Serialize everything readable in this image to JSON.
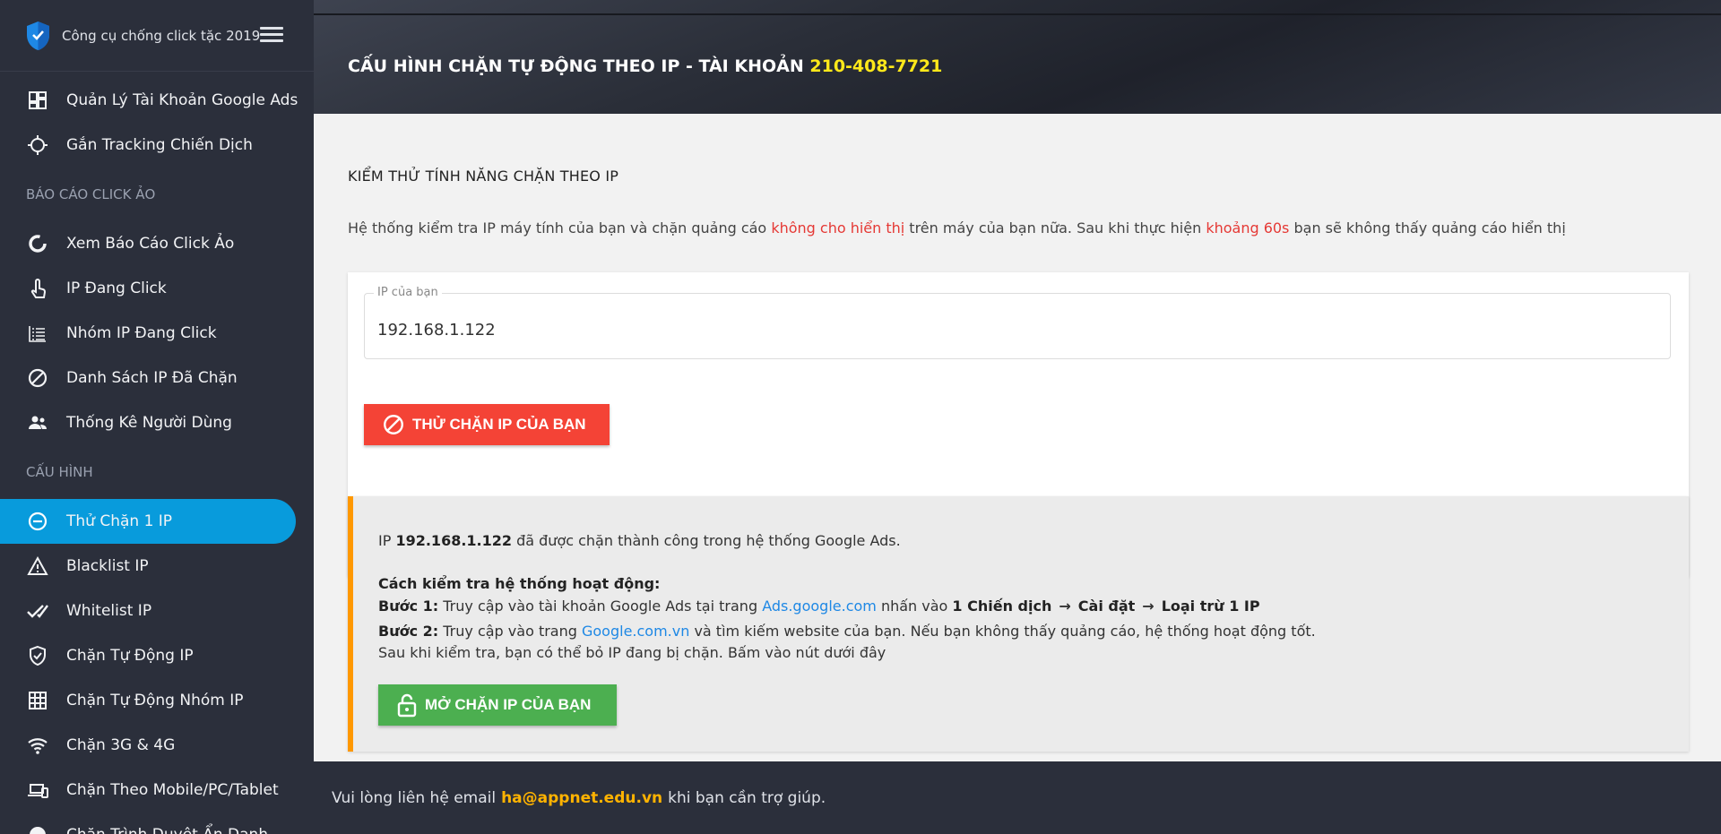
{
  "sidebar": {
    "brand": "Công cụ chống click tặc 2019",
    "items_top": [
      {
        "label": "Quản Lý Tài Khoản Google Ads",
        "icon": "dashboard-icon"
      },
      {
        "label": "Gắn Tracking Chiến Dịch",
        "icon": "crosshair-icon"
      }
    ],
    "section_reports": "BÁO CÁO CLICK ẢO",
    "items_reports": [
      {
        "label": "Xem Báo Cáo Click Ảo",
        "icon": "donut-chart-icon"
      },
      {
        "label": "IP Đang Click",
        "icon": "touch-icon"
      },
      {
        "label": "Nhóm IP Đang Click",
        "icon": "list-icon"
      },
      {
        "label": "Danh Sách IP Đã Chặn",
        "icon": "block-icon"
      },
      {
        "label": "Thống Kê Người Dùng",
        "icon": "users-icon"
      }
    ],
    "section_config": "CẤU HÌNH",
    "items_config": [
      {
        "label": "Thử Chặn 1 IP",
        "icon": "minus-circle-icon",
        "active": true
      },
      {
        "label": "Blacklist IP",
        "icon": "warning-icon"
      },
      {
        "label": "Whitelist IP",
        "icon": "double-check-icon"
      },
      {
        "label": "Chặn Tự Động IP",
        "icon": "shield-check-icon"
      },
      {
        "label": "Chặn Tự Động Nhóm IP",
        "icon": "grid-icon"
      },
      {
        "label": "Chặn 3G & 4G",
        "icon": "wifi-icon"
      },
      {
        "label": "Chặn Theo Mobile/PC/Tablet",
        "icon": "devices-icon"
      },
      {
        "label": "Chặn Trình Duyệt Ẩn Danh",
        "icon": "incognito-icon"
      }
    ]
  },
  "header": {
    "title_prefix": "CẤU HÌNH CHẶN TỰ ĐỘNG THEO IP - TÀI KHOẢN ",
    "account": "210-408-7721"
  },
  "main": {
    "section_title": "KIỂM THỬ TÍNH NĂNG CHẶN THEO IP",
    "desc_1": "Hệ thống kiểm tra IP máy tính của bạn và chặn quảng cáo ",
    "desc_red_1": "không cho hiển thị",
    "desc_2": " trên máy của bạn nữa. Sau khi thực hiện ",
    "desc_red_2": "khoảng 60s",
    "desc_3": " bạn sẽ không thấy quảng cáo hiển thị",
    "ip_label": "IP của bạn",
    "ip_value": "192.168.1.122",
    "block_button": "THỬ CHẶN IP CỦA BẠN"
  },
  "result": {
    "ip_prefix": "IP ",
    "ip": "192.168.1.122",
    "ip_suffix": " đã được chặn thành công trong hệ thống Google Ads.",
    "howto_title": "Cách kiểm tra hệ thống hoạt động:",
    "step1_label": "Bước 1:",
    "step1_text": " Truy cập vào tài khoản Google Ads tại trang ",
    "step1_link": "Ads.google.com",
    "step1_text2": " nhấn vào ",
    "step1_b1": "1 Chiến dịch",
    "step1_b2": "Cài đặt",
    "step1_b3": "Loại trừ 1 IP",
    "arrow": "→",
    "step2_label": "Bước 2:",
    "step2_text": " Truy cập vào trang ",
    "step2_link": "Google.com.vn",
    "step2_text2": " và tìm kiếm website của bạn. Nếu bạn không thấy quảng cáo, hệ thống hoạt động tốt.",
    "after_text": "Sau khi kiểm tra, bạn có thể bỏ IP đang bị chặn. Bấm vào nút dưới đây",
    "unblock_button": "MỞ CHẶN IP CỦA BẠN"
  },
  "footer": {
    "text_1": "Vui lòng liên hệ email",
    "email": "ha@appnet.edu.vn",
    "text_2": "khi bạn cần trợ giúp."
  },
  "colors": {
    "accent": "#089bdc",
    "account_yellow": "#ffe81a",
    "danger": "#f44336",
    "success": "#4caf50",
    "warning_border": "#ff9800",
    "link": "#1e88e5",
    "email": "#ffb300"
  }
}
